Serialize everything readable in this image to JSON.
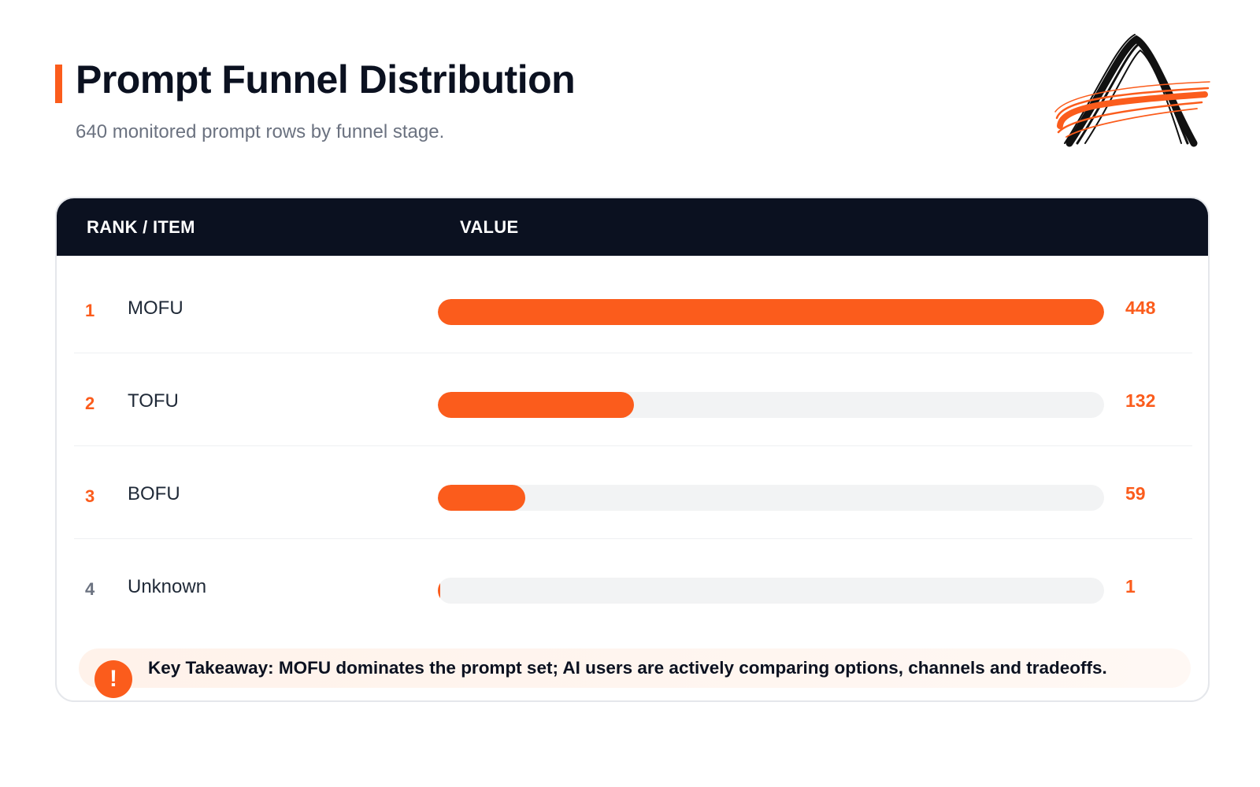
{
  "header": {
    "title": "Prompt Funnel Distribution",
    "subtitle": "640 monitored prompt rows by funnel stage."
  },
  "logo": {
    "icon": "brand-a-logo-icon",
    "colors": [
      "#111111",
      "#fb5c1c"
    ]
  },
  "table": {
    "col_rank_item": "RANK / ITEM",
    "col_value": "VALUE"
  },
  "chart_data": {
    "type": "bar",
    "orientation": "horizontal",
    "title": "Prompt Funnel Distribution",
    "subtitle": "640 monitored prompt rows by funnel stage.",
    "columns": [
      "RANK / ITEM",
      "VALUE"
    ],
    "ranks": [
      "1",
      "2",
      "3",
      "4"
    ],
    "categories": [
      "MOFU",
      "TOFU",
      "BOFU",
      "Unknown"
    ],
    "values": [
      448,
      132,
      59,
      1
    ],
    "value_labels": [
      "448",
      "132",
      "59",
      "1"
    ],
    "xlim": [
      0,
      448
    ],
    "grid": false,
    "legend": "none"
  },
  "takeaway": {
    "icon": "exclamation-icon",
    "text": "Key Takeaway: MOFU dominates the prompt set; AI users are actively comparing options, channels and tradeoffs."
  },
  "colors": {
    "accent": "#fb5c1c",
    "header_bg": "#0b1120",
    "track": "#f2f3f4",
    "muted_rank": "#6b7280"
  }
}
